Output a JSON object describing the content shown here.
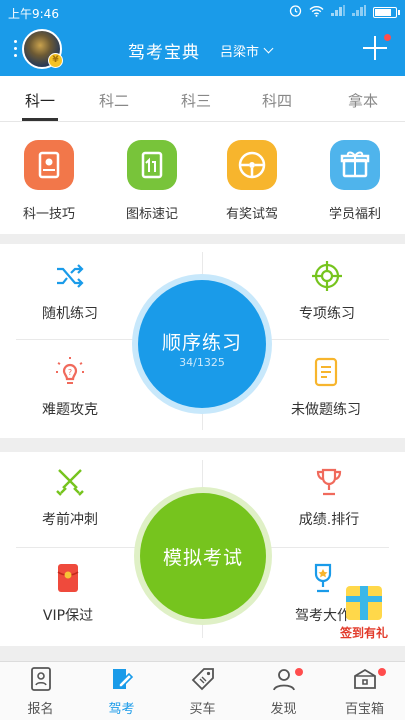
{
  "status_bar": {
    "time": "上午9:46",
    "battery_level": 0.85
  },
  "header": {
    "title": "驾考宝典",
    "city": "吕梁市"
  },
  "tabs": [
    {
      "label": "科一",
      "active": true
    },
    {
      "label": "科二",
      "active": false
    },
    {
      "label": "科三",
      "active": false
    },
    {
      "label": "科四",
      "active": false
    },
    {
      "label": "拿本",
      "active": false
    }
  ],
  "tools": [
    {
      "label": "科一技巧",
      "icon": "tips-book-icon",
      "color": "#f2774a"
    },
    {
      "label": "图标速记",
      "icon": "traffic-sign-icon",
      "color": "#78c43a"
    },
    {
      "label": "有奖试驾",
      "icon": "steering-wheel-icon",
      "color": "#f7b52d"
    },
    {
      "label": "学员福利",
      "icon": "gift-icon",
      "color": "#4fb4ec"
    }
  ],
  "practice": {
    "random": "随机练习",
    "special": "专项练习",
    "difficult": "难题攻克",
    "undone": "未做题练习",
    "main": {
      "label": "顺序练习",
      "progress": "34/1325"
    }
  },
  "exam": {
    "sprint": "考前冲刺",
    "score_rank": "成绩.排行",
    "vip": "VIP保过",
    "contest": "驾考大作",
    "main": {
      "label": "模拟考试"
    }
  },
  "gift_badge": {
    "label": "签到有礼"
  },
  "bottom_nav": [
    {
      "label": "报名",
      "icon": "id-card-icon",
      "active": false,
      "dot": false
    },
    {
      "label": "驾考",
      "icon": "pencil-doc-icon",
      "active": true,
      "dot": false
    },
    {
      "label": "买车",
      "icon": "price-tag-icon",
      "active": false,
      "dot": false
    },
    {
      "label": "发现",
      "icon": "person-icon",
      "active": false,
      "dot": true
    },
    {
      "label": "百宝箱",
      "icon": "treasure-box-icon",
      "active": false,
      "dot": true
    }
  ],
  "colors": {
    "primary": "#1a9be9",
    "green": "#76c41e",
    "red_dot": "#ff4d4d"
  }
}
